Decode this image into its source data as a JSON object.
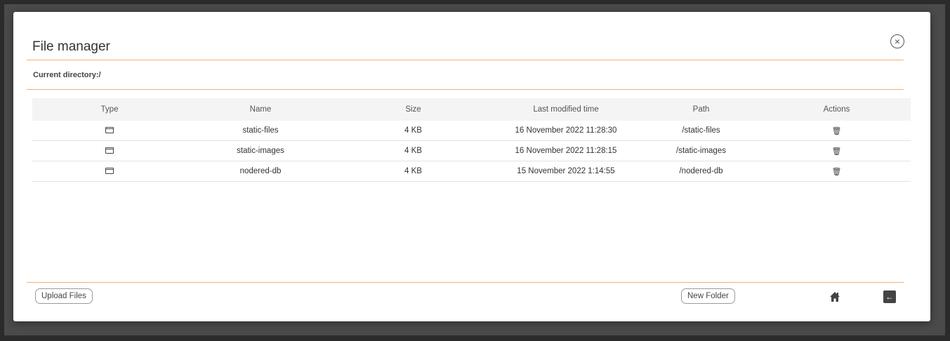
{
  "modal": {
    "title": "File manager",
    "close_icon": "close-circle-icon",
    "current_directory_label": "Current directory:/"
  },
  "table": {
    "columns": [
      "Type",
      "Name",
      "Size",
      "Last modified time",
      "Path",
      "Actions"
    ],
    "rows": [
      {
        "type_icon": "folder-icon",
        "name": "static-files",
        "size": "4 KB",
        "modified": "16 November 2022 11:28:30",
        "path": "/static-files",
        "action_icon": "trash-icon"
      },
      {
        "type_icon": "folder-icon",
        "name": "static-images",
        "size": "4 KB",
        "modified": "16 November 2022 11:28:15",
        "path": "/static-images",
        "action_icon": "trash-icon"
      },
      {
        "type_icon": "folder-icon",
        "name": "nodered-db",
        "size": "4 KB",
        "modified": "15 November 2022 1:14:55",
        "path": "/nodered-db",
        "action_icon": "trash-icon"
      }
    ]
  },
  "footer": {
    "upload_label": "Upload Files",
    "new_folder_label": "New Folder",
    "home_icon": "home-icon",
    "back_icon": "back-arrow-icon"
  },
  "colors": {
    "accent_rule": "#f0b07a",
    "backdrop": "#4a4a4a"
  }
}
